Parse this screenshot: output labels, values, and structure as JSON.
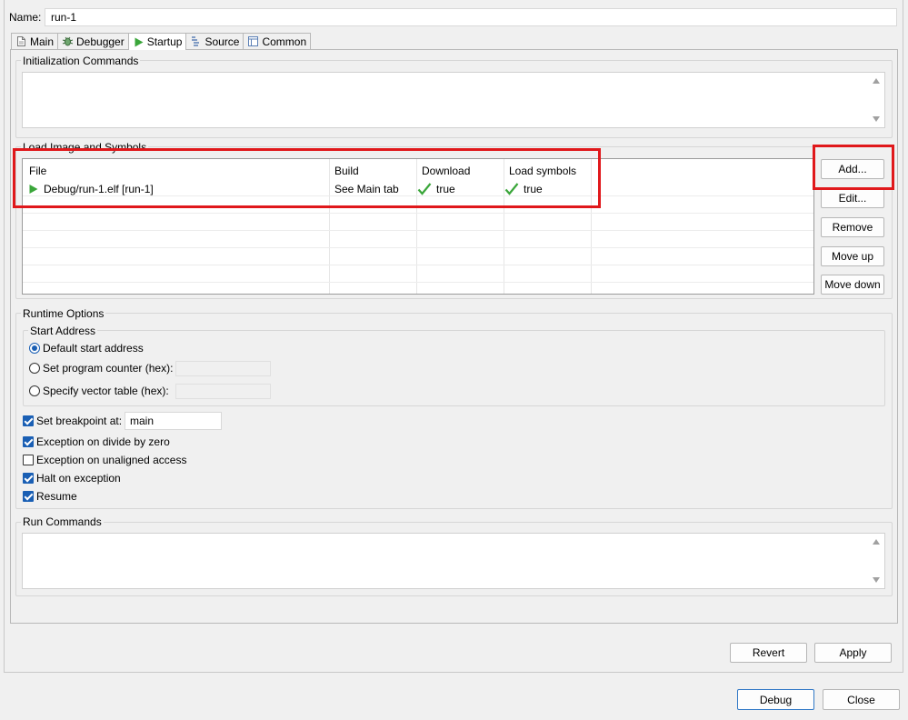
{
  "name_label": "Name:",
  "name_value": "run-1",
  "tabs": [
    {
      "label": "Main",
      "icon": "document-icon"
    },
    {
      "label": "Debugger",
      "icon": "bug-icon"
    },
    {
      "label": "Startup",
      "icon": "play-icon"
    },
    {
      "label": "Source",
      "icon": "source-icon"
    },
    {
      "label": "Common",
      "icon": "window-icon"
    }
  ],
  "active_tab": "Startup",
  "init_commands": {
    "title": "Initialization Commands",
    "value": ""
  },
  "load_image": {
    "title": "Load Image and Symbols",
    "columns": [
      "File",
      "Build",
      "Download",
      "Load symbols"
    ],
    "rows": [
      {
        "file": "Debug/run-1.elf [run-1]",
        "build": "See Main tab",
        "download": "true",
        "load_symbols": "true"
      }
    ],
    "buttons": {
      "add": "Add...",
      "edit": "Edit...",
      "remove": "Remove",
      "move_up": "Move up",
      "move_down": "Move down"
    }
  },
  "runtime": {
    "title": "Runtime Options",
    "start_address": {
      "title": "Start Address",
      "default": "Default start address",
      "pc": "Set program counter (hex):",
      "vector": "Specify vector table (hex):",
      "selected": "default"
    },
    "set_breakpoint": {
      "label": "Set breakpoint at:",
      "value": "main",
      "checked": true
    },
    "exception_divide": {
      "label": "Exception on divide by zero",
      "checked": true
    },
    "exception_unaligned": {
      "label": "Exception on unaligned access",
      "checked": false
    },
    "halt_exception": {
      "label": "Halt on exception",
      "checked": true
    },
    "resume": {
      "label": "Resume",
      "checked": true
    }
  },
  "run_commands": {
    "title": "Run Commands",
    "value": ""
  },
  "footer": {
    "revert": "Revert",
    "apply": "Apply",
    "debug": "Debug",
    "close": "Close"
  },
  "colors": {
    "highlight": "#e0181b",
    "accent": "#1a5fb4",
    "check_green": "#3aa63a"
  }
}
